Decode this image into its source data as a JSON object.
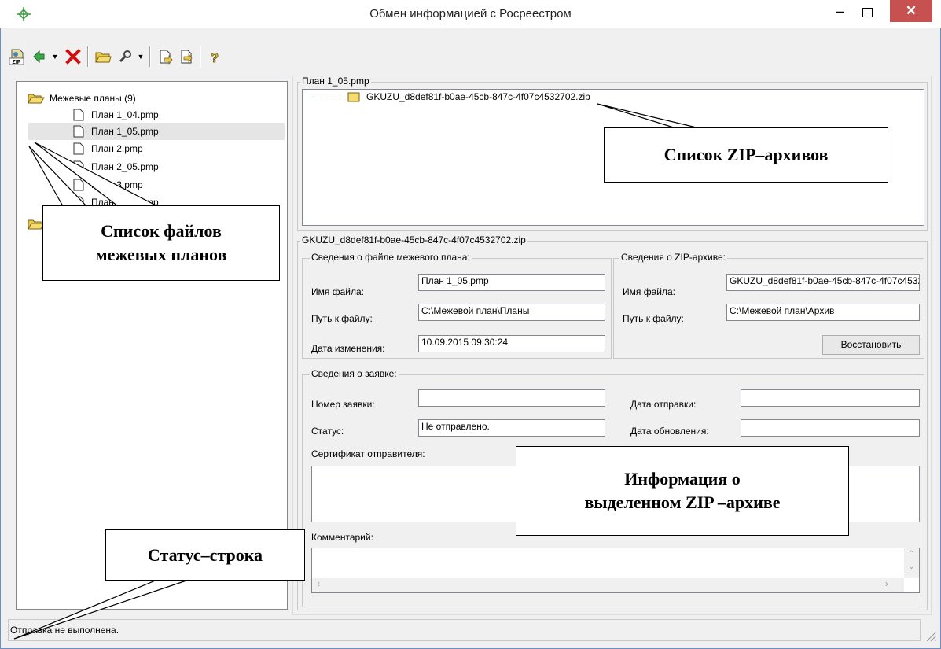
{
  "window": {
    "title": "Обмен информацией с Росреестром",
    "minimize": "–",
    "close": "✕"
  },
  "toolbar": {
    "buttons": [
      {
        "name": "zip-button",
        "icon": "zip-icon"
      },
      {
        "name": "refresh-button",
        "icon": "refresh-icon"
      },
      {
        "name": "delete-button",
        "icon": "delete-icon"
      },
      {
        "name": "open-folder-button",
        "icon": "folder-icon"
      },
      {
        "name": "settings-button",
        "icon": "wrench-icon"
      },
      {
        "name": "export-button",
        "icon": "document-icon"
      },
      {
        "name": "import-button",
        "icon": "document-import-icon"
      },
      {
        "name": "help-button",
        "icon": "help-icon"
      }
    ]
  },
  "tree": {
    "root": "Межевые планы (9)",
    "items": [
      "План 1_04.pmp",
      "План 1_05.pmp",
      "План 2.pmp",
      "План 2_05.pmp",
      "План 3.pmp",
      "План 3_05.pmp"
    ],
    "selected": "План 1_05.pmp"
  },
  "zip_panel": {
    "title": "План 1_05.pmp",
    "item": "GKUZU_d8def81f-b0ae-45cb-847c-4f07c4532702.zip"
  },
  "details": {
    "title": "GKUZU_d8def81f-b0ae-45cb-847c-4f07c4532702.zip",
    "plan_file": {
      "title": "Сведения о файле межевого плана:",
      "name_label": "Имя файла:",
      "name_value": "План 1_05.pmp",
      "path_label": "Путь к файлу:",
      "path_value": "C:\\Межевой план\\Планы",
      "date_label": "Дата изменения:",
      "date_value": "10.09.2015 09:30:24"
    },
    "zip_file": {
      "title": "Сведения о ZIP-архиве:",
      "name_label": "Имя файла:",
      "name_value": "GKUZU_d8def81f-b0ae-45cb-847c-4f07c4532702.zip",
      "path_label": "Путь к файлу:",
      "path_value": "C:\\Межевой план\\Архив",
      "restore_button": "Восстановить"
    },
    "request": {
      "title": "Сведения о заявке:",
      "number_label": "Номер заявки:",
      "number_value": "",
      "status_label": "Статус:",
      "status_value": "Не отправлено.",
      "sent_label": "Дата отправки:",
      "sent_value": "",
      "updated_label": "Дата обновления:",
      "updated_value": "",
      "cert_label": "Сертификат отправителя:",
      "comment_label": "Комментарий:"
    }
  },
  "statusbar": {
    "text": "Отправка не выполнена."
  },
  "callouts": {
    "zip_list": "Список ZIP–архивов",
    "files_list_1": "Список файлов",
    "files_list_2": "межевых планов",
    "info_1": "Информация о",
    "info_2": "выделенном ZIP –архиве",
    "status": "Статус–строка"
  }
}
